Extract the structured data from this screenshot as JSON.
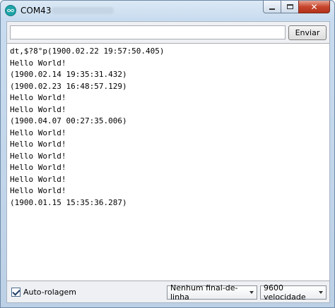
{
  "window": {
    "title": "COM43"
  },
  "send": {
    "input_value": "",
    "button_label": "Enviar"
  },
  "output_lines": [
    "dt,$?8°p(1900.02.22 19:57:50.405)",
    "Hello World!",
    "(1900.02.14 19:35:31.432)",
    "(1900.02.23 16:48:57.129)",
    "Hello World!",
    "Hello World!",
    "(1900.04.07 00:27:35.006)",
    "Hello World!",
    "Hello World!",
    "Hello World!",
    "Hello World!",
    "Hello World!",
    "Hello World!",
    "(1900.01.15 15:35:36.287)"
  ],
  "bottom": {
    "autoscroll_label": "Auto-rolagem",
    "autoscroll_checked": true,
    "line_ending_selected": "Nenhum final-de-linha",
    "baud_selected": "9600 velocidade"
  },
  "colors": {
    "close_button": "#c7452d",
    "titlebar": "#dce9f5"
  }
}
